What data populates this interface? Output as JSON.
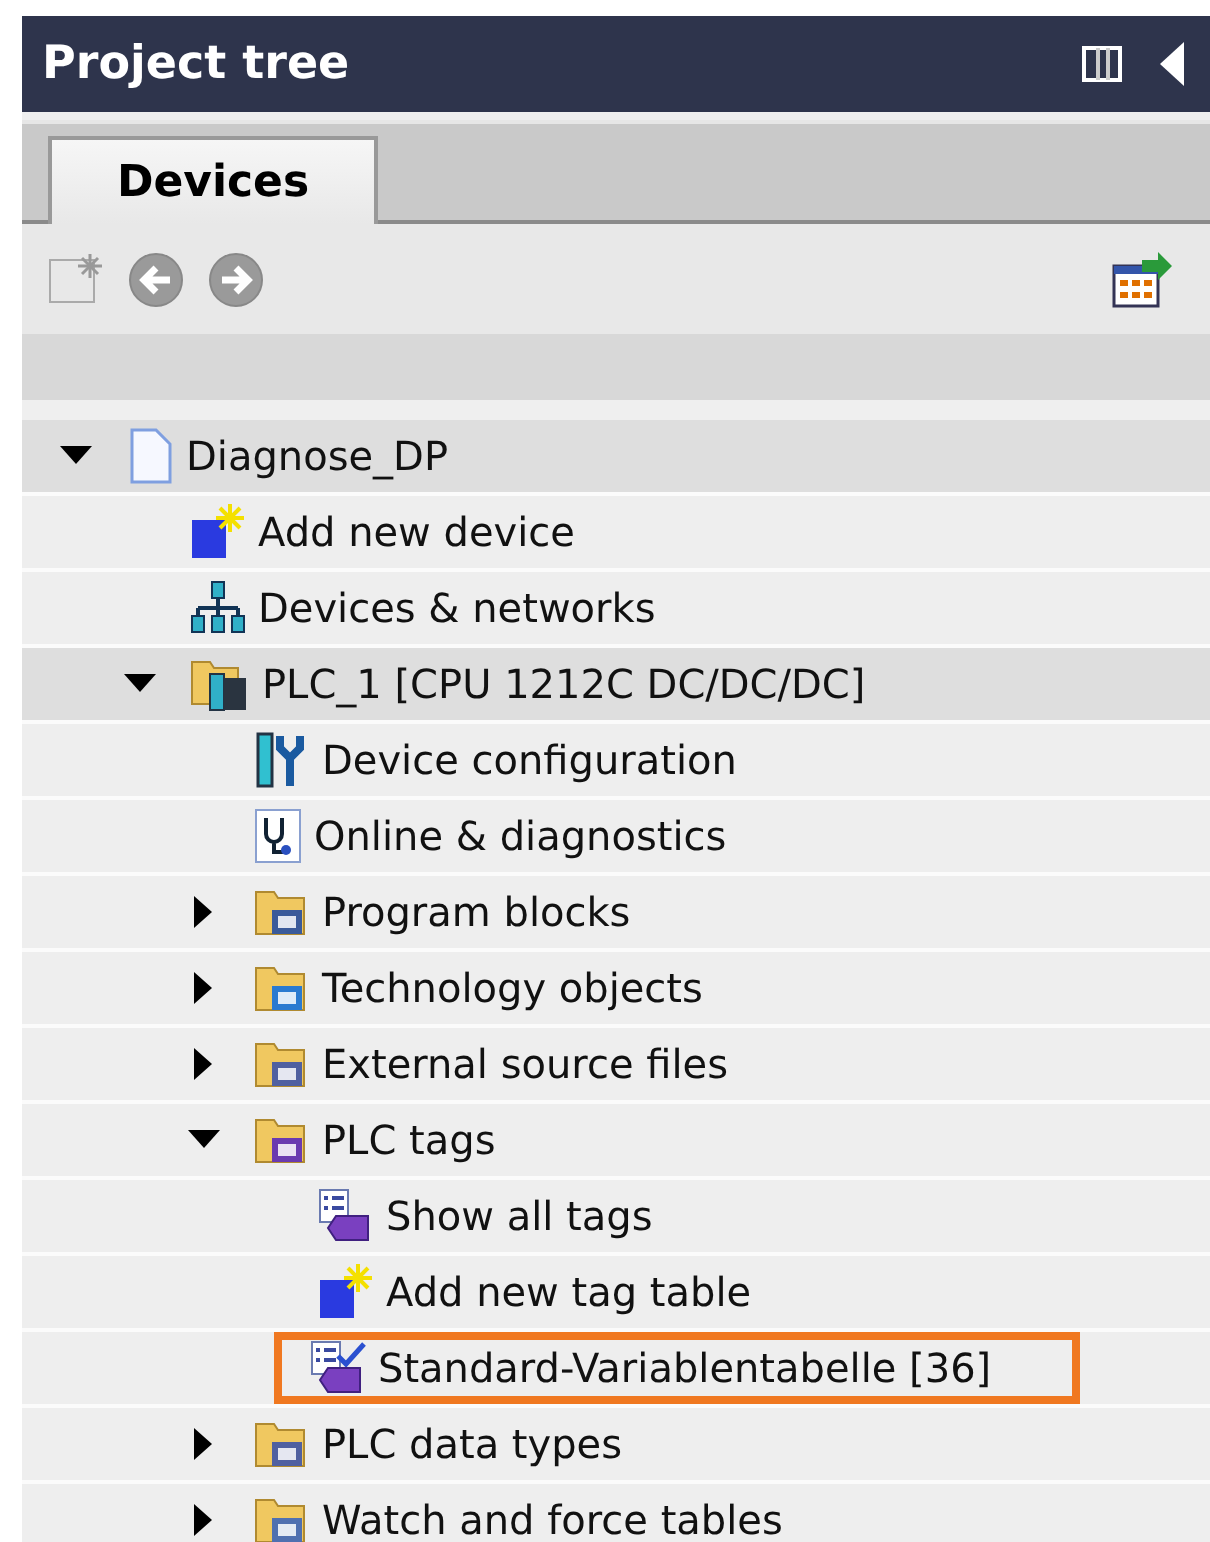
{
  "window": {
    "title": "Project tree"
  },
  "tabs": [
    {
      "label": "Devices",
      "selected": true
    }
  ],
  "tree": [
    {
      "label": "Diagnose_DP",
      "kind": "project",
      "expanded": true,
      "children": [
        {
          "label": "Add new device",
          "kind": "add"
        },
        {
          "label": "Devices & networks",
          "kind": "network"
        },
        {
          "label": "PLC_1 [CPU 1212C DC/DC/DC]",
          "kind": "plc",
          "expanded": true,
          "children": [
            {
              "label": "Device configuration",
              "kind": "config"
            },
            {
              "label": "Online & diagnostics",
              "kind": "diag"
            },
            {
              "label": "Program blocks",
              "kind": "folder-blocks",
              "expanded": false
            },
            {
              "label": "Technology objects",
              "kind": "folder-tech",
              "expanded": false
            },
            {
              "label": "External source files",
              "kind": "folder-source",
              "expanded": false
            },
            {
              "label": "PLC tags",
              "kind": "folder-tags",
              "expanded": true,
              "children": [
                {
                  "label": "Show all tags",
                  "kind": "tags"
                },
                {
                  "label": "Add new tag table",
                  "kind": "add"
                },
                {
                  "label": "Standard-Variablentabelle [36]",
                  "kind": "tagtable",
                  "marked": true
                }
              ]
            },
            {
              "label": "PLC data types",
              "kind": "folder-types",
              "expanded": false
            },
            {
              "label": "Watch and force tables",
              "kind": "folder-watch",
              "expanded": false
            }
          ]
        }
      ]
    }
  ]
}
